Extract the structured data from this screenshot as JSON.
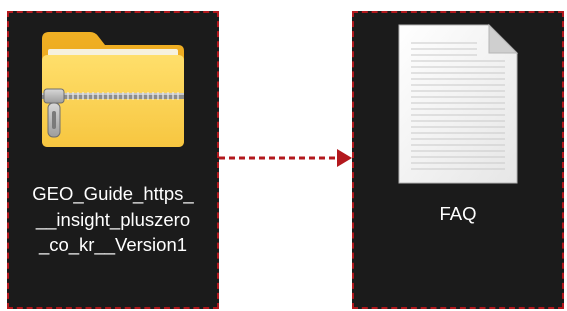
{
  "source_item": {
    "label": "GEO_Guide_https___insight_pluszero_co_kr__Version1",
    "icon": "zip-folder-icon"
  },
  "target_item": {
    "label": "FAQ",
    "icon": "document-icon"
  },
  "connector": {
    "style": "dashed-arrow",
    "color": "#b3181d"
  },
  "colors": {
    "tile_background": "#1b1b1b",
    "tile_border": "#b3181d",
    "label_text": "#ffffff"
  }
}
